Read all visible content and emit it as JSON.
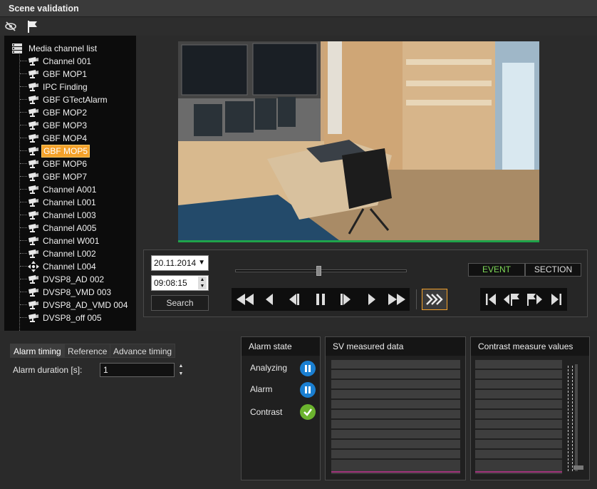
{
  "window": {
    "title": "Scene validation"
  },
  "toolbar": {
    "icons": [
      "eye-hide-icon",
      "flag-icon"
    ]
  },
  "tree": {
    "root_label": "Media channel list",
    "items": [
      {
        "label": "Channel 001",
        "icon": "camera-icon"
      },
      {
        "label": "GBF MOP1",
        "icon": "camera-icon"
      },
      {
        "label": "IPC Finding",
        "icon": "camera-icon"
      },
      {
        "label": "GBF GTectAlarm",
        "icon": "camera-icon"
      },
      {
        "label": "GBF MOP2",
        "icon": "camera-icon"
      },
      {
        "label": "GBF MOP3",
        "icon": "camera-icon"
      },
      {
        "label": "GBF MOP4",
        "icon": "camera-icon"
      },
      {
        "label": "GBF MOP5",
        "icon": "camera-icon",
        "selected": true
      },
      {
        "label": "GBF MOP6",
        "icon": "camera-icon"
      },
      {
        "label": "GBF MOP7",
        "icon": "camera-icon"
      },
      {
        "label": "Channel A001",
        "icon": "camera-icon"
      },
      {
        "label": "Channel L001",
        "icon": "camera-icon"
      },
      {
        "label": "Channel L003",
        "icon": "camera-icon"
      },
      {
        "label": "Channel A005",
        "icon": "camera-icon"
      },
      {
        "label": "Channel W001",
        "icon": "camera-icon"
      },
      {
        "label": "Channel L002",
        "icon": "camera-icon"
      },
      {
        "label": "Channel L004",
        "icon": "ptz-icon"
      },
      {
        "label": "DVSP8_AD 002",
        "icon": "camera-icon"
      },
      {
        "label": "DVSP8_VMD 003",
        "icon": "camera-icon"
      },
      {
        "label": "DVSP8_AD_VMD 004",
        "icon": "camera-icon"
      },
      {
        "label": "DVSP8_off 005",
        "icon": "camera-icon"
      }
    ]
  },
  "playback": {
    "date": "20.11.2014",
    "time": "09:08:15",
    "search_label": "Search",
    "slider_fraction": 0.48,
    "event_label": "EVENT",
    "section_label": "SECTION"
  },
  "tabs": [
    {
      "label": "Alarm timing",
      "active": true
    },
    {
      "label": "Reference",
      "active": false
    },
    {
      "label": "Advance timing",
      "active": false
    }
  ],
  "alarm_timing": {
    "duration_label": "Alarm duration [s]:",
    "duration_value": "1"
  },
  "alarm_state": {
    "title": "Alarm state",
    "rows": [
      {
        "label": "Analyzing",
        "icon": "pause-icon",
        "color": "#1a7fd1"
      },
      {
        "label": "Alarm",
        "icon": "pause-icon",
        "color": "#1a7fd1"
      },
      {
        "label": "Contrast",
        "icon": "check-icon",
        "color": "#6bb32e"
      }
    ]
  },
  "sv_measured": {
    "title": "SV measured data"
  },
  "contrast_measure": {
    "title": "Contrast measure values"
  },
  "colors": {
    "accent": "#f4a12a",
    "event": "#7ed957",
    "status_green": "#1fa34a"
  }
}
